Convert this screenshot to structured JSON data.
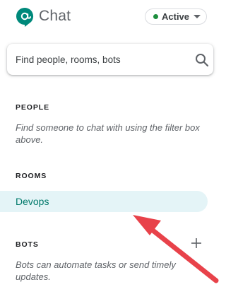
{
  "header": {
    "app_name": "Chat",
    "logo_icon": "chat-logo-icon",
    "status": {
      "label": "Active",
      "dot_color": "#1e8e3e",
      "icon": "chevron-down-icon"
    }
  },
  "search": {
    "placeholder": "Find people, rooms, bots",
    "value": "",
    "icon": "search-icon"
  },
  "sections": {
    "people": {
      "title": "PEOPLE",
      "hint": "Find someone to chat with using the filter box above."
    },
    "rooms": {
      "title": "ROOMS",
      "items": [
        {
          "label": "Devops",
          "selected": true
        }
      ]
    },
    "bots": {
      "title": "BOTS",
      "add_icon": "plus-icon",
      "hint": "Bots can automate tasks or send timely updates."
    }
  },
  "annotation": {
    "icon": "arrow-annotation",
    "color": "#e8424a"
  },
  "colors": {
    "brand": "#00897b",
    "selected_bg": "#e4f4f7",
    "selected_text": "#00796b"
  }
}
